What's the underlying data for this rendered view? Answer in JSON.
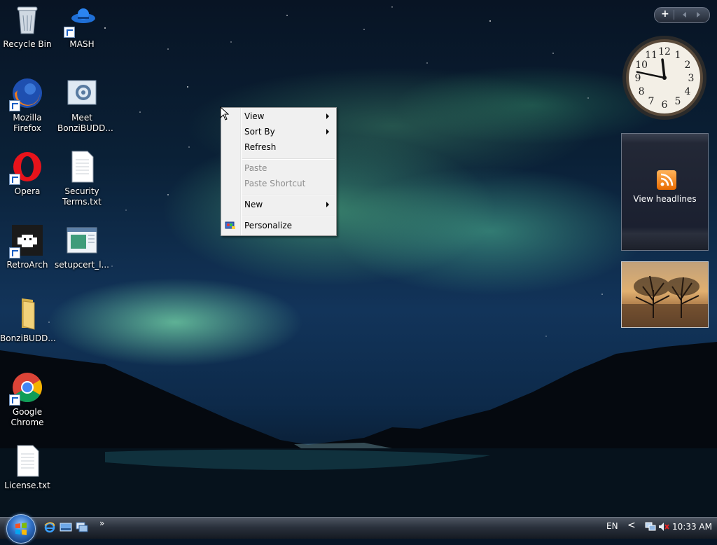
{
  "desktop_icons": [
    {
      "id": "recycle-bin",
      "label": "Recycle Bin"
    },
    {
      "id": "mash",
      "label": "MASH"
    },
    {
      "id": "firefox",
      "label": "Mozilla Firefox"
    },
    {
      "id": "bonzi-meet",
      "label": "Meet BonziBUDD..."
    },
    {
      "id": "opera",
      "label": "Opera"
    },
    {
      "id": "security-terms",
      "label": "Security Terms.txt"
    },
    {
      "id": "retroarch",
      "label": "RetroArch"
    },
    {
      "id": "setupcert",
      "label": "setupcert_l..."
    },
    {
      "id": "bonzi-folder",
      "label": "BonziBUDD..."
    },
    {
      "id": "chrome",
      "label": "Google Chrome"
    },
    {
      "id": "license",
      "label": "License.txt"
    }
  ],
  "context_menu": {
    "items": [
      {
        "label": "View",
        "has_submenu": true,
        "enabled": true
      },
      {
        "label": "Sort By",
        "has_submenu": true,
        "enabled": true
      },
      {
        "label": "Refresh",
        "has_submenu": false,
        "enabled": true
      },
      {
        "label": "Paste",
        "has_submenu": false,
        "enabled": false
      },
      {
        "label": "Paste Shortcut",
        "has_submenu": false,
        "enabled": false
      },
      {
        "label": "New",
        "has_submenu": true,
        "enabled": true
      },
      {
        "label": "Personalize",
        "has_submenu": false,
        "enabled": true,
        "icon": "personalize-icon"
      }
    ]
  },
  "gadgets": {
    "controls": {
      "add": "+"
    },
    "clock": {
      "numerals": [
        "12",
        "1",
        "2",
        "3",
        "4",
        "5",
        "6",
        "7",
        "8",
        "9",
        "10",
        "11"
      ],
      "time_shown": "11:47"
    },
    "feed_headlines": {
      "label": "View headlines"
    }
  },
  "taskbar": {
    "language": "EN",
    "chevron": "»",
    "tray_chevron": "<",
    "time": "10:33 AM"
  },
  "colors": {
    "menu_bg": "#f0f0f0",
    "disabled_text": "#8d8d8d",
    "accent": "#2f6fc4"
  }
}
